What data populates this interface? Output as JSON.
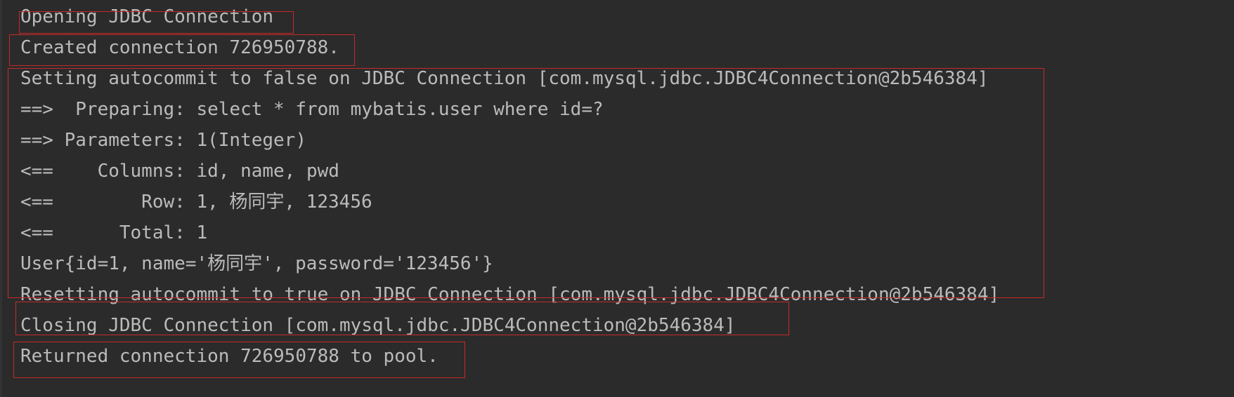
{
  "console": {
    "lines": [
      "Opening JDBC Connection",
      "Created connection 726950788.",
      "Setting autocommit to false on JDBC Connection [com.mysql.jdbc.JDBC4Connection@2b546384]",
      "==>  Preparing: select * from mybatis.user where id=?",
      "==> Parameters: 1(Integer)",
      "<==    Columns: id, name, pwd",
      "<==        Row: 1, 杨同宇, 123456",
      "<==      Total: 1",
      "User{id=1, name='杨同宇', password='123456'}",
      "Resetting autocommit to true on JDBC Connection [com.mysql.jdbc.JDBC4Connection@2b546384]",
      "Closing JDBC Connection [com.mysql.jdbc.JDBC4Connection@2b546384]",
      "Returned connection 726950788 to pool."
    ]
  },
  "colors": {
    "background": "#2b2b2b",
    "text": "#bbbbbb",
    "highlight_border": "#c62a2a"
  }
}
